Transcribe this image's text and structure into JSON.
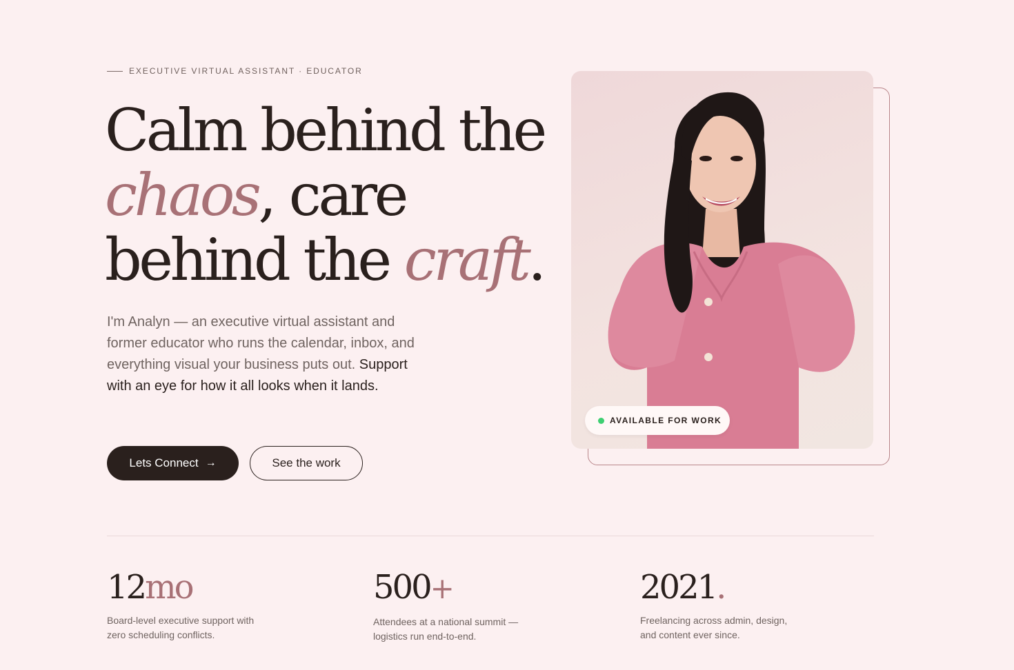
{
  "hero": {
    "eyebrow": "EXECUTIVE VIRTUAL ASSISTANT · EDUCATOR",
    "headline": {
      "line1": "Calm behind the",
      "line2_accent": "chaos",
      "line2_rest": ", care",
      "line3_start": "behind the ",
      "line3_accent": "craft",
      "line3_end": "."
    },
    "intro": "I'm Analyn — an executive virtual assistant and former educator who runs the calendar, inbox, and everything visual your business puts out.",
    "intro_strong": "Support with an eye for how it all looks when it lands.",
    "primary_button": "Lets Connect",
    "primary_button_icon": "arrow-right-icon",
    "secondary_button": "See the work"
  },
  "portrait": {
    "badge": "AVAILABLE FOR WORK",
    "badge_status_color": "#3ecf72"
  },
  "stats": [
    {
      "number": "12",
      "accent": "mo",
      "desc": "Board-level executive support with zero scheduling conflicts."
    },
    {
      "number": "500",
      "accent": "+",
      "desc": "Attendees at a national summit — logistics run end-to-end."
    },
    {
      "number": "2021",
      "accent": ".",
      "desc": "Freelancing across admin, design, and content ever since."
    }
  ],
  "colors": {
    "background": "#fcf0f1",
    "ink": "#2a201d",
    "accent": "#a87176",
    "muted": "#6f6360"
  }
}
